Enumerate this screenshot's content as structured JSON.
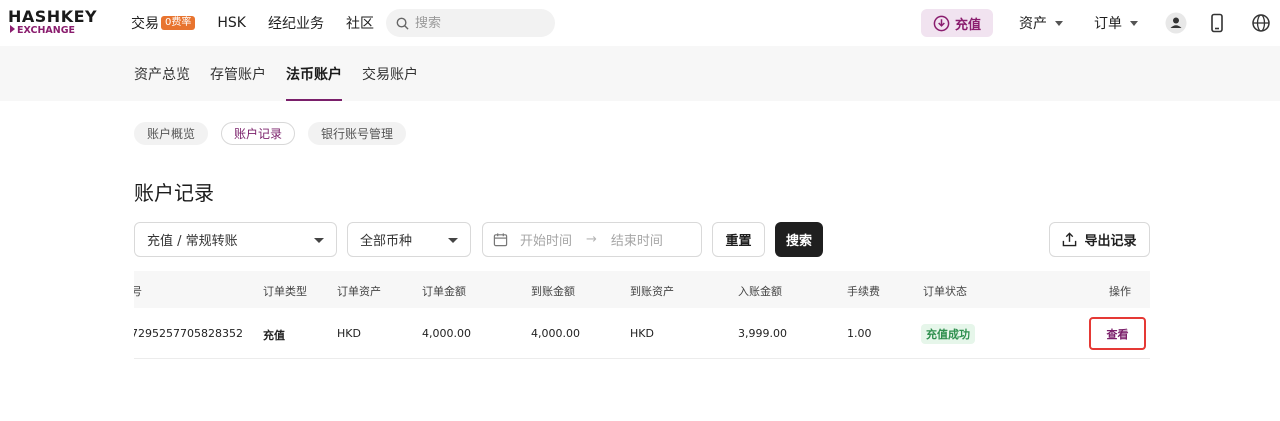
{
  "header": {
    "logo": {
      "top": "HASHKEY",
      "bottom": "EXCHANGE"
    },
    "nav": [
      {
        "label": "交易",
        "badge": "0费率"
      },
      {
        "label": "HSK"
      },
      {
        "label": "经纪业务"
      },
      {
        "label": "社区"
      }
    ],
    "search": {
      "placeholder": "搜索"
    },
    "deposit_label": "充值",
    "assets_label": "资产",
    "orders_label": "订单",
    "icons": [
      "user-icon",
      "mobile-icon",
      "globe-icon"
    ]
  },
  "tabs": [
    "资产总览",
    "存管账户",
    "法币账户",
    "交易账户"
  ],
  "active_tab": "法币账户",
  "pills": [
    "账户概览",
    "账户记录",
    "银行账号管理"
  ],
  "active_pill": "账户记录",
  "page_title": "账户记录",
  "filters": {
    "type_select": "充值 / 常规转账",
    "currency_select": "全部币种",
    "start_placeholder": "开始时间",
    "end_placeholder": "结束时间",
    "reset_label": "重置",
    "search_label": "搜索",
    "export_label": "导出记录"
  },
  "table": {
    "columns": [
      "号",
      "订单类型",
      "订单资产",
      "订单金额",
      "到账金额",
      "到账资产",
      "入账金额",
      "手续费",
      "订单状态",
      "操作"
    ],
    "rows": [
      {
        "id": "7295257705828352",
        "type": "充值",
        "order_asset": "HKD",
        "order_amount": "4,000.00",
        "received_amount": "4,000.00",
        "received_asset": "HKD",
        "credited_amount": "3,999.00",
        "fee": "1.00",
        "status": "充值成功",
        "action": "查看"
      }
    ]
  },
  "colors": {
    "brand": "#7a1f6a",
    "badge": "#e8742f",
    "success": "#2f8f4e",
    "highlight": "#e53935"
  }
}
